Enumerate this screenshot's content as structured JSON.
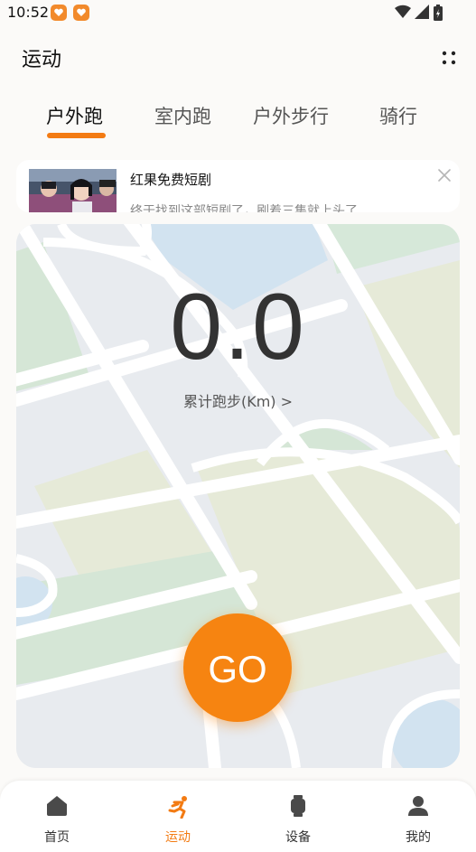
{
  "status_bar": {
    "time": "10:52"
  },
  "header": {
    "title": "运动",
    "more_icon": "dots-grid-icon"
  },
  "tabs": [
    {
      "label": "户外跑",
      "active": true
    },
    {
      "label": "室内跑",
      "active": false
    },
    {
      "label": "户外步行",
      "active": false
    },
    {
      "label": "骑行",
      "active": false
    }
  ],
  "ad": {
    "title": "红果免费短剧",
    "subtitle": "终于找到这部短剧了，刷着三集就上头了"
  },
  "stats": {
    "distance_value": "0.0",
    "distance_label": "累计跑步(Km) >"
  },
  "go_button": {
    "label": "GO",
    "color": "#f68411"
  },
  "bottom_nav": [
    {
      "label": "首页",
      "icon": "home-icon",
      "active": false
    },
    {
      "label": "运动",
      "icon": "running-icon",
      "active": true
    },
    {
      "label": "设备",
      "icon": "watch-icon",
      "active": false
    },
    {
      "label": "我的",
      "icon": "user-icon",
      "active": false
    }
  ],
  "colors": {
    "accent": "#f37b13",
    "background": "#fbfaf8"
  }
}
